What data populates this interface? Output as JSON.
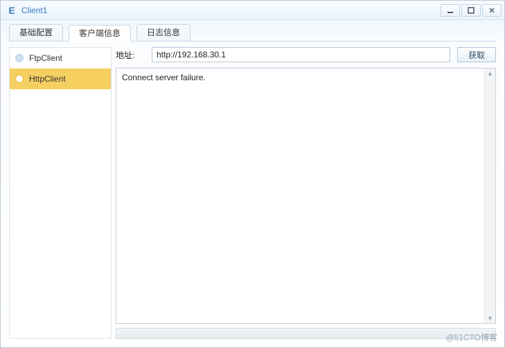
{
  "window": {
    "title": "Client1",
    "icon_glyph": "E"
  },
  "window_controls": {
    "minimize_tooltip": "Minimize",
    "maximize_tooltip": "Maximize",
    "close_tooltip": "Close"
  },
  "tabs": [
    {
      "label": "基础配置",
      "active": false
    },
    {
      "label": "客户端信息",
      "active": true
    },
    {
      "label": "日志信息",
      "active": false
    }
  ],
  "sidebar": {
    "items": [
      {
        "label": "FtpClient",
        "selected": false
      },
      {
        "label": "HttpClient",
        "selected": true
      }
    ]
  },
  "main": {
    "address_label": "地址:",
    "address_value": "http://192.168.30.1",
    "fetch_label": "获取",
    "output_text": "Connect server failure."
  },
  "watermark": "@51CTO博客"
}
